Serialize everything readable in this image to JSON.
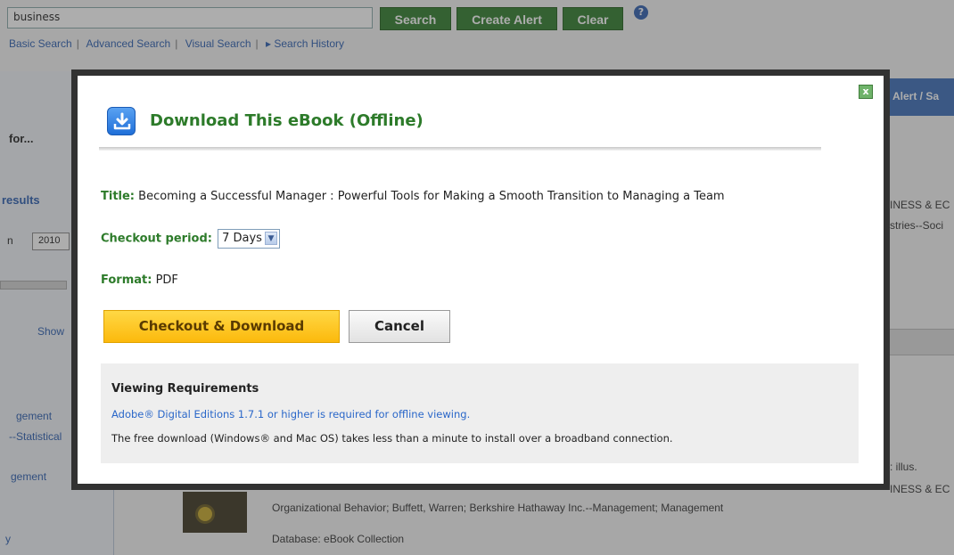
{
  "background": {
    "search_value": "business",
    "buttons": {
      "search": "Search",
      "create_alert": "Create Alert",
      "clear": "Clear"
    },
    "help": "?",
    "sub_links": [
      "Basic Search",
      "Advanced Search",
      "Visual Search",
      "Search History"
    ],
    "left_panel": {
      "for_text": "for...",
      "results_text": "results",
      "n_text": "n",
      "year_value": "2010",
      "show_text": "Show",
      "text_1": "gement",
      "text_2": "--Statistical",
      "text_3": "gement",
      "text_4": "y"
    },
    "right_panel": {
      "tab_label": "Alert / Sa",
      "text_1": "INESS & EC",
      "text_2": "stries--Soci",
      "text_3": ": illus.",
      "text_4": "INESS & EC"
    },
    "result_subjects": "Organizational Behavior; Buffett, Warren; Berkshire Hathaway Inc.--Management; Management",
    "result_database": "Database: eBook Collection"
  },
  "modal": {
    "title": "Download This eBook (Offline)",
    "close_symbol": "x",
    "title_label": "Title:",
    "title_value": "Becoming a Successful Manager : Powerful Tools for Making a Smooth Transition to Managing a Team",
    "period_label": "Checkout period:",
    "period_value": "7 Days",
    "format_label": "Format:",
    "format_value": "PDF",
    "checkout_button": "Checkout & Download",
    "cancel_button": "Cancel",
    "requirements": {
      "heading": "Viewing Requirements",
      "link": "Adobe® Digital Editions 1.7.1 or higher is required for offline viewing.",
      "note": "The free download (Windows® and Mac OS) takes less than a minute to install over a broadband connection."
    }
  },
  "colors": {
    "accent_green": "#2d7b2a",
    "button_yellow": "#fcb90c",
    "link_blue": "#2a67c9",
    "modal_border": "#323232"
  },
  "icons": [
    "download-icon",
    "close-icon",
    "help-icon",
    "chevron-down-icon"
  ]
}
